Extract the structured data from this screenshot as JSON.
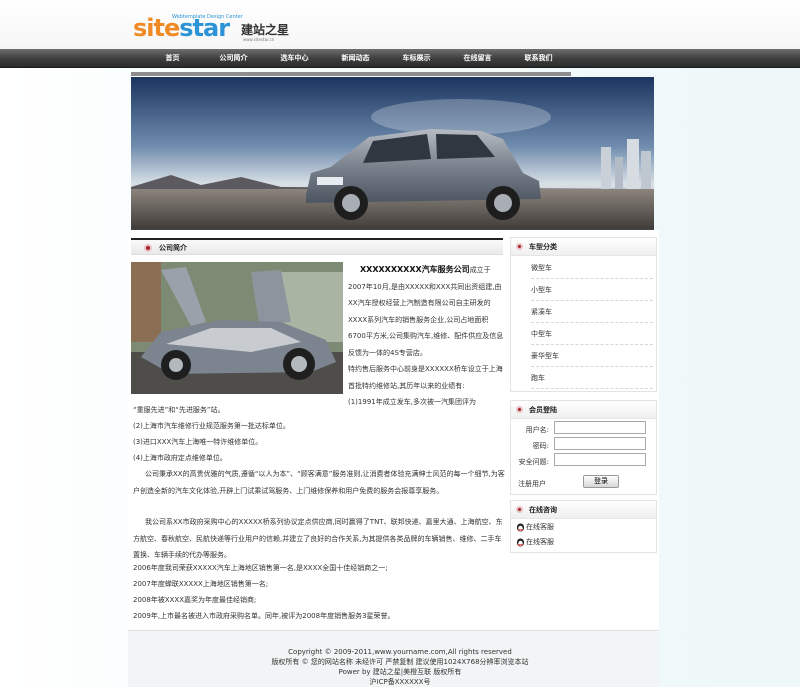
{
  "header": {
    "logo_site": "site",
    "logo_star": "star",
    "logo_tagline": "Webtemplate Design Center",
    "logo_cn": "建站之星",
    "logo_url": "www.sitestar.cn"
  },
  "nav": {
    "items": [
      "首页",
      "公司简介",
      "选车中心",
      "新闻动态",
      "车标展示",
      "在线留言",
      "联系我们"
    ]
  },
  "section": {
    "title": "公司简介"
  },
  "intro": {
    "company_name": "XXXXXXXXXX汽车服务公司",
    "p1_rest": "成立于2007年10月,是由XXXXX和XXX共同出资组建,由XX汽车授权经营上汽制造有限公司自主研发的XXXX系列汽车的销售服务企业,公司占地面积6700平方米,公司集购汽车,维修、配件供应及信息反馈为一体的4S专营店。",
    "p2": "特约售后服务中心前身是XXXXXX桥车设立于上海首批特约维修站,其历年以来的业绩有:",
    "item1a": "(1)1991年成立发车,多次被一汽集团评为",
    "item1b": "“重服先进”和“先进服务”站。",
    "item2": "(2)上海市汽车维修行业规范服务第一批达标单位。",
    "item3": "(3)进口XXX汽车上海唯一特许维修单位。",
    "item4": "(4)上海市政府定点维修单位。",
    "p3": "公司秉承XX的高贵优雅的气质,遵循“以人为本”、“顾客满意”服务准则,让消费者体验充满绅士风范的每一个细节,为客户创造全新的汽车文化体验,开辟上门试乘试驾服务、上门维修保养和用户免费的服务会报尊享服务。",
    "p4": "我公司系XX市政府采购中心的XXXXX桥系列协议定点供应商,同时赢得了TNT、联邦快递、嘉里大通、上海航空、东方航空、春秋航空、民航快递等行业用户的信赖,并建立了良好的合作关系,为其提供各类品牌的车辆销售、维修、二手车置换、车辆手续的代办等服务。",
    "l1": "2006年度我司荣获XXXXX汽车上海地区销售第一名,是XXXX全国十佳经销商之一;",
    "l2": "2007年度蝉联XXXXX上海地区销售第一名;",
    "l3": "2008年被XXXX嘉奖为年度最佳经销商;",
    "l4": "2009年,上市最名被进入市政府采购名单。同年,被评为2008年度销售服务3星荣誉。"
  },
  "sidebar": {
    "categories": {
      "title": "车型分类",
      "items": [
        "微型车",
        "小型车",
        "紧凑车",
        "中型车",
        "豪华型车",
        "跑车"
      ]
    },
    "login": {
      "title": "会员登陆",
      "username_label": "用户名:",
      "password_label": "密码:",
      "question_label": "安全问题:",
      "register_link": "注册用户",
      "login_button": "登录"
    },
    "online": {
      "title": "在线咨询",
      "items": [
        "在线客服",
        "在线客服"
      ]
    }
  },
  "footer": {
    "line1": "Copyright © 2009-2011,www.yourname.com,All rights reserved",
    "line2": "版权所有 © 您的网站名称  未经许可 严禁复制 建议使用1024X768分辨率浏览本站",
    "line3": "Power by 建站之星|美橙互联 版权所有",
    "line4": "沪ICP备XXXXXX号"
  },
  "colors": {
    "accent_red": "#a4232a",
    "nav_dark": "#3d3d3d",
    "logo_orange": "#f08a24",
    "logo_blue": "#2c94d6"
  }
}
